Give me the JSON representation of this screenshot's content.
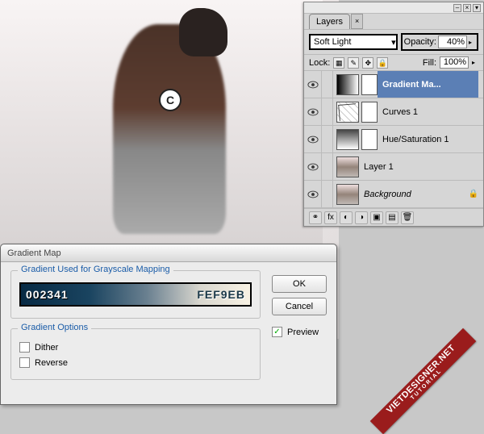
{
  "canvas": {
    "badge_text": "C"
  },
  "layers_panel": {
    "tab_label": "Layers",
    "tab_close": "×",
    "blend_mode": "Soft Light",
    "opacity_label": "Opacity:",
    "opacity_value": "40%",
    "lock_label": "Lock:",
    "fill_label": "Fill:",
    "fill_value": "100%",
    "layers": [
      {
        "name": "Gradient Ma...",
        "selected": true,
        "has_mask": true,
        "thumb": "grad",
        "italic": false,
        "locked": false
      },
      {
        "name": "Curves 1",
        "selected": false,
        "has_mask": true,
        "thumb": "curves",
        "italic": false,
        "locked": false
      },
      {
        "name": "Hue/Saturation 1",
        "selected": false,
        "has_mask": true,
        "thumb": "hs",
        "italic": false,
        "locked": false
      },
      {
        "name": "Layer 1",
        "selected": false,
        "has_mask": false,
        "thumb": "img",
        "italic": false,
        "locked": false
      },
      {
        "name": "Background",
        "selected": false,
        "has_mask": false,
        "thumb": "img",
        "italic": true,
        "locked": true
      }
    ],
    "footer_icons": [
      "link-icon",
      "fx-icon",
      "mask-icon",
      "adjust-icon",
      "group-icon",
      "new-icon",
      "trash-icon"
    ]
  },
  "dialog": {
    "title": "Gradient Map",
    "fieldset1_legend": "Gradient Used for Grayscale Mapping",
    "fieldset2_legend": "Gradient Options",
    "hex_left": "002341",
    "hex_right": "FEF9EB",
    "dither_label": "Dither",
    "reverse_label": "Reverse",
    "ok_label": "OK",
    "cancel_label": "Cancel",
    "preview_label": "Preview",
    "preview_checked": true
  },
  "watermark": {
    "line1": "VIETDESIGNER.NET",
    "line2": "TUTORIAL"
  }
}
